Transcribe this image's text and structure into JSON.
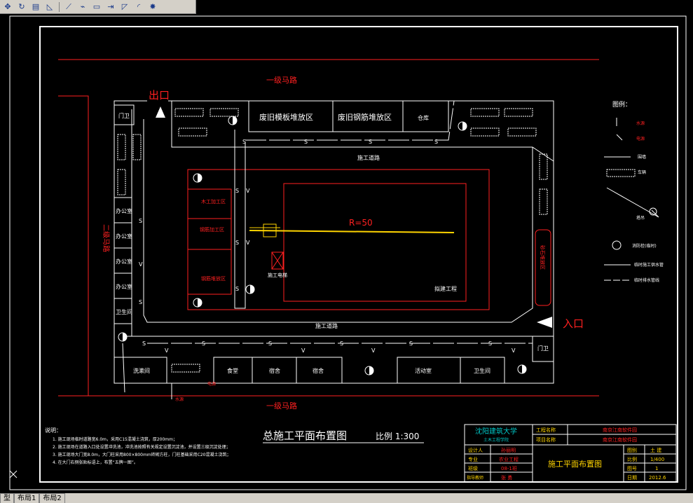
{
  "toolbar": {
    "icons": [
      "pan-icon",
      "orbit-icon",
      "zoom-window-icon",
      "measure-icon",
      "line-icon",
      "polyline-icon",
      "rectangle-icon",
      "move-icon",
      "arc-icon",
      "curve-icon",
      "burst-icon"
    ]
  },
  "plan": {
    "road_top": "一级马路",
    "road_bottom": "一级马路",
    "exit_label": "出口",
    "entry_label": "入口",
    "side_road": "二级马路",
    "area_old_wood": "废旧模板堆放区",
    "area_old_steel": "废旧钢筋堆放区",
    "warehouse": "仓库",
    "guard_left": "门卫",
    "guard_right": "门卫",
    "road_inner_top": "施工道路",
    "road_inner_bottom": "施工道路",
    "radius": "R=50",
    "building": "拟建工程",
    "elevator": "施工电梯",
    "yard_1": "木工加工区",
    "yard_2": "钢筋加工区",
    "yard_3": "钢筋堆放区",
    "right_storage": "砂石堆放区",
    "offices": [
      "办公室",
      "办公室",
      "办公室",
      "办公室"
    ],
    "toilet_left": "卫生间",
    "bottom_rooms": [
      "洗漱间",
      "食堂",
      "宿舍",
      "宿舍",
      "活动室",
      "卫生间"
    ],
    "water_source": "水源",
    "power_source": "电源",
    "s_mark": "S",
    "v_mark": "V"
  },
  "legend": {
    "title": "图例：",
    "items": [
      "水源",
      "电源",
      "围墙",
      "车辆",
      "塔吊",
      "消防栓(临时)",
      "临时施工供水管",
      "临时排水管线"
    ]
  },
  "notes": {
    "heading": "说明：",
    "lines": [
      "1. 施工现场临时道路宽6.0m，采用C15混凝土浇筑，厚200mm；",
      "2. 施工现场在道路入口处设置冲洗池，冲洗池按照有关规定设置沉淀池，并设置三级沉淀处理；",
      "3. 施工现场大门宽8.0m，大门柱采用800×800mm砖砌方柱，门柱基础采用C20混凝土浇筑；",
      "4. 在大门右侧张贴标语上，布置“五牌一图”。"
    ]
  },
  "drawing_title": "总施工平面布置图",
  "drawing_scale": "比例 1:300",
  "title_block": {
    "school": "沈阳建筑大学",
    "dept": "土木工程学院",
    "project_label": "工程名称",
    "project_value": "南京江南软件园",
    "item_label": "项目名称",
    "item_value": "南京江南软件园",
    "designer_label": "设计人",
    "designer_value": "孙丽明",
    "major_label": "专业",
    "major_value": "农业工程",
    "class_label": "班级",
    "class_value": "08-1班",
    "advisor_label": "指导教师",
    "advisor_value": "张 勇",
    "sheet_title": "施工平面布置图",
    "type_label": "图别",
    "type_value": "土 建",
    "scale_label": "比例",
    "scale_value": "1/400",
    "no_label": "图号",
    "no_value": "1",
    "date_label": "日期",
    "date_value": "2012.6"
  },
  "tabs": [
    "型",
    "布局1",
    "布局2"
  ],
  "colors": {
    "red": "#ff2020",
    "white": "#ffffff",
    "yellow": "#ffd400",
    "cyan": "#00c8c8",
    "bg": "#000000"
  }
}
